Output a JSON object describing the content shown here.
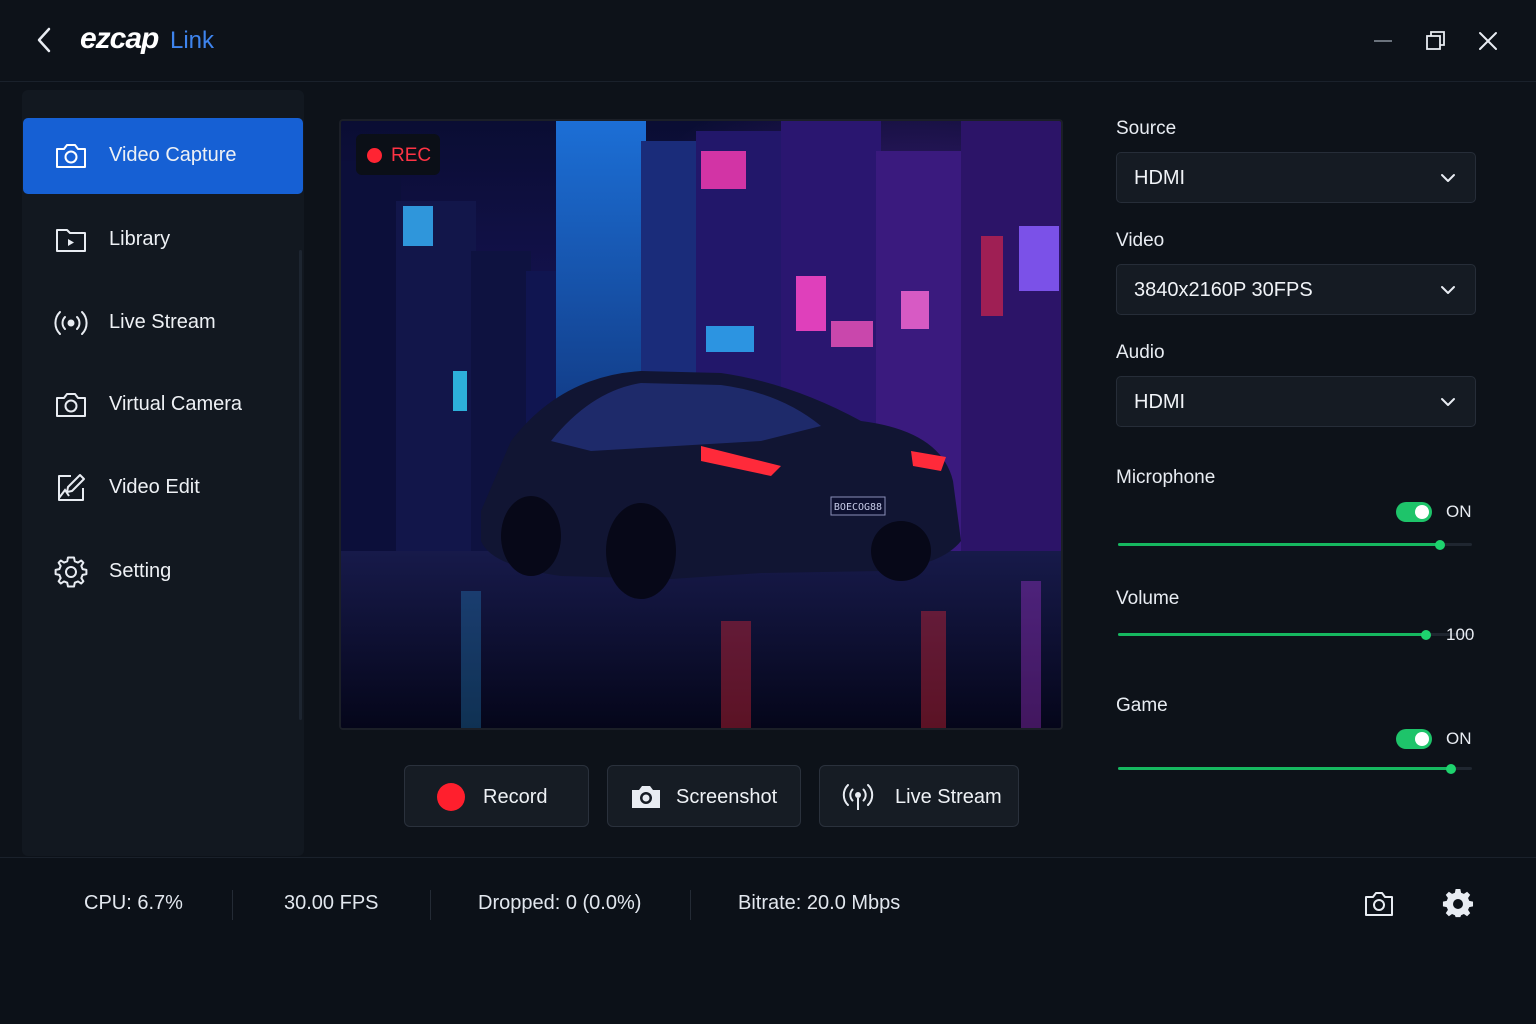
{
  "app": {
    "logo": "ezcap",
    "logo_sub": "Link"
  },
  "titlebar": {
    "icons": [
      "back-arrow-icon",
      "minimize-icon",
      "restore-icon",
      "close-icon"
    ]
  },
  "sidebar": {
    "items": [
      {
        "label": "Video Capture",
        "icon": "camera-icon",
        "active": true
      },
      {
        "label": "Library",
        "icon": "folder-icon",
        "active": false
      },
      {
        "label": "Live Stream",
        "icon": "broadcast-icon",
        "active": false
      },
      {
        "label": "Virtual Camera",
        "icon": "camera-icon",
        "active": false
      },
      {
        "label": "Video Edit",
        "icon": "edit-icon",
        "active": false
      },
      {
        "label": "Setting",
        "icon": "gear-icon",
        "active": false
      }
    ]
  },
  "preview": {
    "rec_label": "REC",
    "plate": "BOECOG88",
    "colors": {
      "rec": "#ff2433",
      "accent": "#1660d4"
    }
  },
  "actions": {
    "record": "Record",
    "screenshot": "Screenshot",
    "live_stream": "Live Stream"
  },
  "settings": {
    "source": {
      "label": "Source",
      "value": "HDMI"
    },
    "video": {
      "label": "Video",
      "value": "3840x2160P 30FPS"
    },
    "audio": {
      "label": "Audio",
      "value": "HDMI"
    },
    "microphone": {
      "label": "Microphone",
      "state": "ON",
      "level": 0.91
    },
    "volume": {
      "label": "Volume",
      "value": "100",
      "level": 0.87
    },
    "game": {
      "label": "Game",
      "state": "ON",
      "level": 0.94
    },
    "green": "#1ec46a"
  },
  "status": {
    "cpu": "CPU: 6.7%",
    "fps": "30.00 FPS",
    "dropped": "Dropped: 0 (0.0%)",
    "bitrate": "Bitrate: 20.0 Mbps"
  }
}
